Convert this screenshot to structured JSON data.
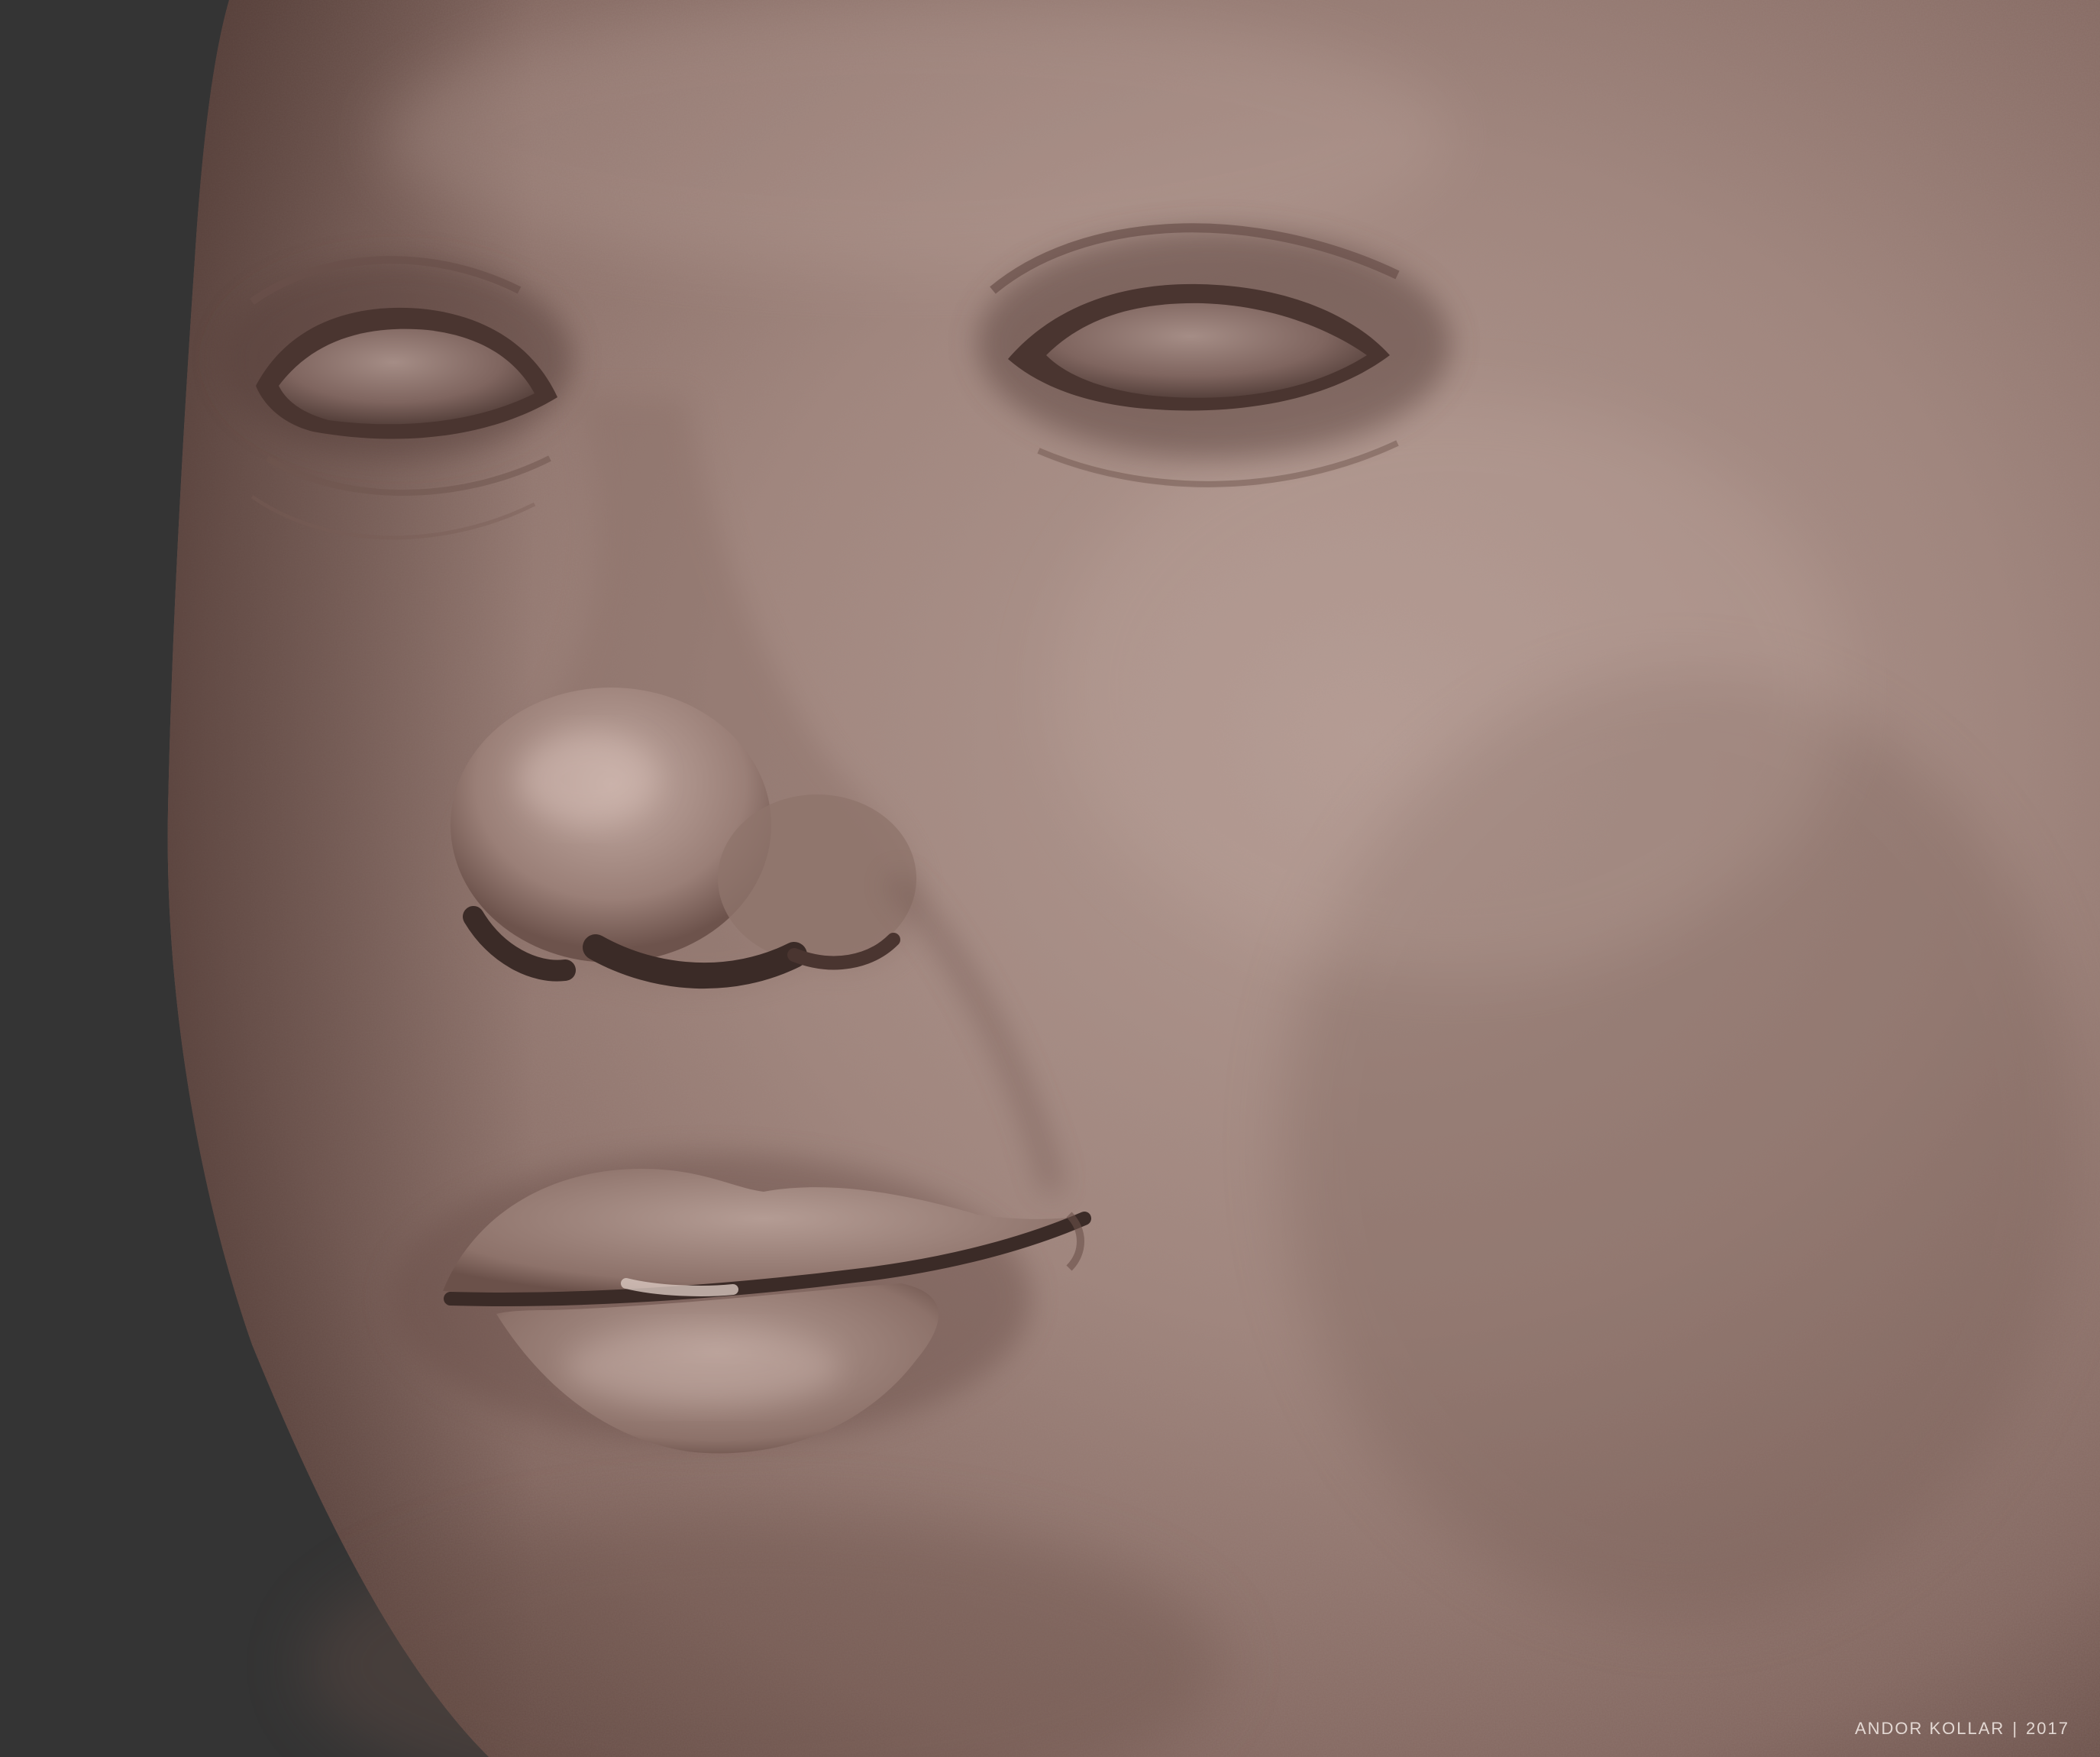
{
  "image": {
    "subject": "clay-shaded 3D sculpt of a face (close-up)",
    "colors": {
      "background": "#343434",
      "skin_light": "#b49b93",
      "skin_mid": "#957a72",
      "skin_dark": "#6a5049",
      "shadow": "#3b2b27"
    }
  },
  "credit": {
    "author": "ANDOR KOLLAR",
    "separator": "|",
    "year": "2017"
  }
}
